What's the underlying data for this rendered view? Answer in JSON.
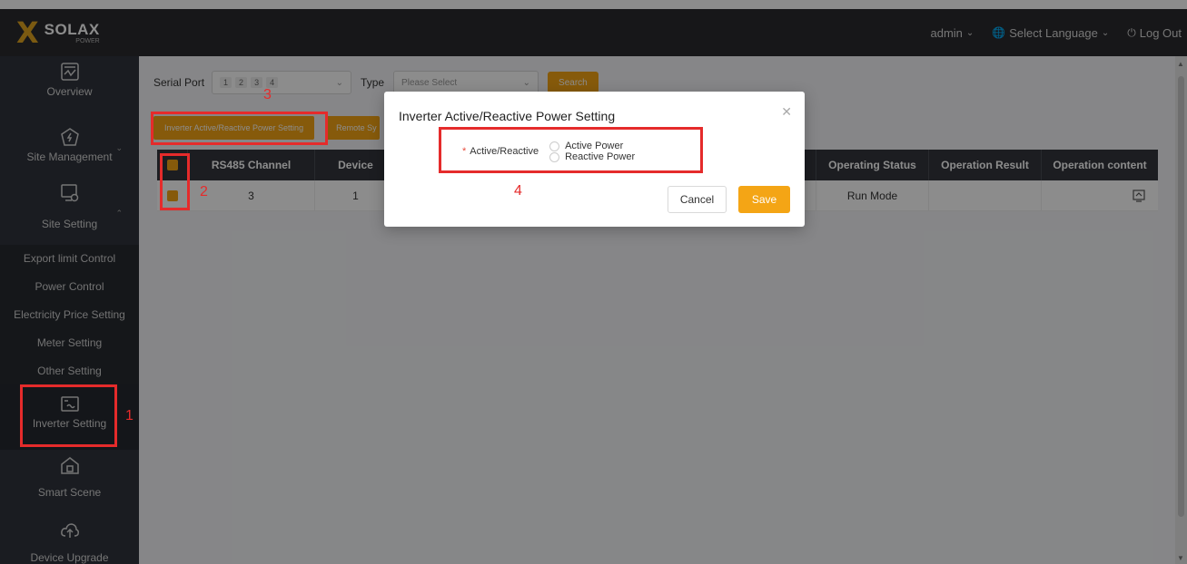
{
  "brand": {
    "logo_mark": "X",
    "name": "SOLAX",
    "sub": "POWER"
  },
  "topnav": {
    "user": "admin",
    "language": "Select Language",
    "logout": "Log Out"
  },
  "sidebar": {
    "items": [
      {
        "label": "Overview",
        "icon": "dashboard-icon"
      },
      {
        "label": "Site Management",
        "icon": "power-icon"
      },
      {
        "label": "Site Setting",
        "icon": "settings-monitor-icon"
      },
      {
        "label": "Inverter Setting",
        "icon": "inverter-icon"
      },
      {
        "label": "Smart Scene",
        "icon": "smart-home-icon"
      },
      {
        "label": "Device Upgrade",
        "icon": "cloud-upload-icon"
      }
    ],
    "submenu": [
      "Export limit Control",
      "Power Control",
      "Electricity Price Setting",
      "Meter Setting",
      "Other Setting"
    ]
  },
  "filter": {
    "serial_port_label": "Serial Port",
    "port_tags": [
      "1",
      "2",
      "3",
      "4"
    ],
    "type_label": "Type",
    "type_placeholder": "Please Select",
    "search_label": "Search"
  },
  "toolbar": {
    "btn1": "Inverter Active/Reactive Power Setting",
    "btn2": "Remote Sy"
  },
  "table": {
    "columns": [
      "RS485 Channel",
      "Device",
      "Operating Status",
      "Operation Result",
      "Operation content"
    ],
    "rows": [
      {
        "channel": "3",
        "device": "1",
        "status": "Run Mode",
        "result": ""
      }
    ]
  },
  "modal": {
    "title": "Inverter Active/Reactive Power Setting",
    "field_label": "Active/Reactive",
    "required_mark": "*",
    "options": [
      "Active Power",
      "Reactive Power"
    ],
    "cancel": "Cancel",
    "save": "Save"
  },
  "annotations": {
    "n1": "1",
    "n2": "2",
    "n3": "3",
    "n4": "4"
  },
  "colors": {
    "accent": "#f4a515",
    "highlight": "#e52b2b",
    "sidebar_bg": "#30343c",
    "topbar_bg": "#2a2a2e"
  }
}
